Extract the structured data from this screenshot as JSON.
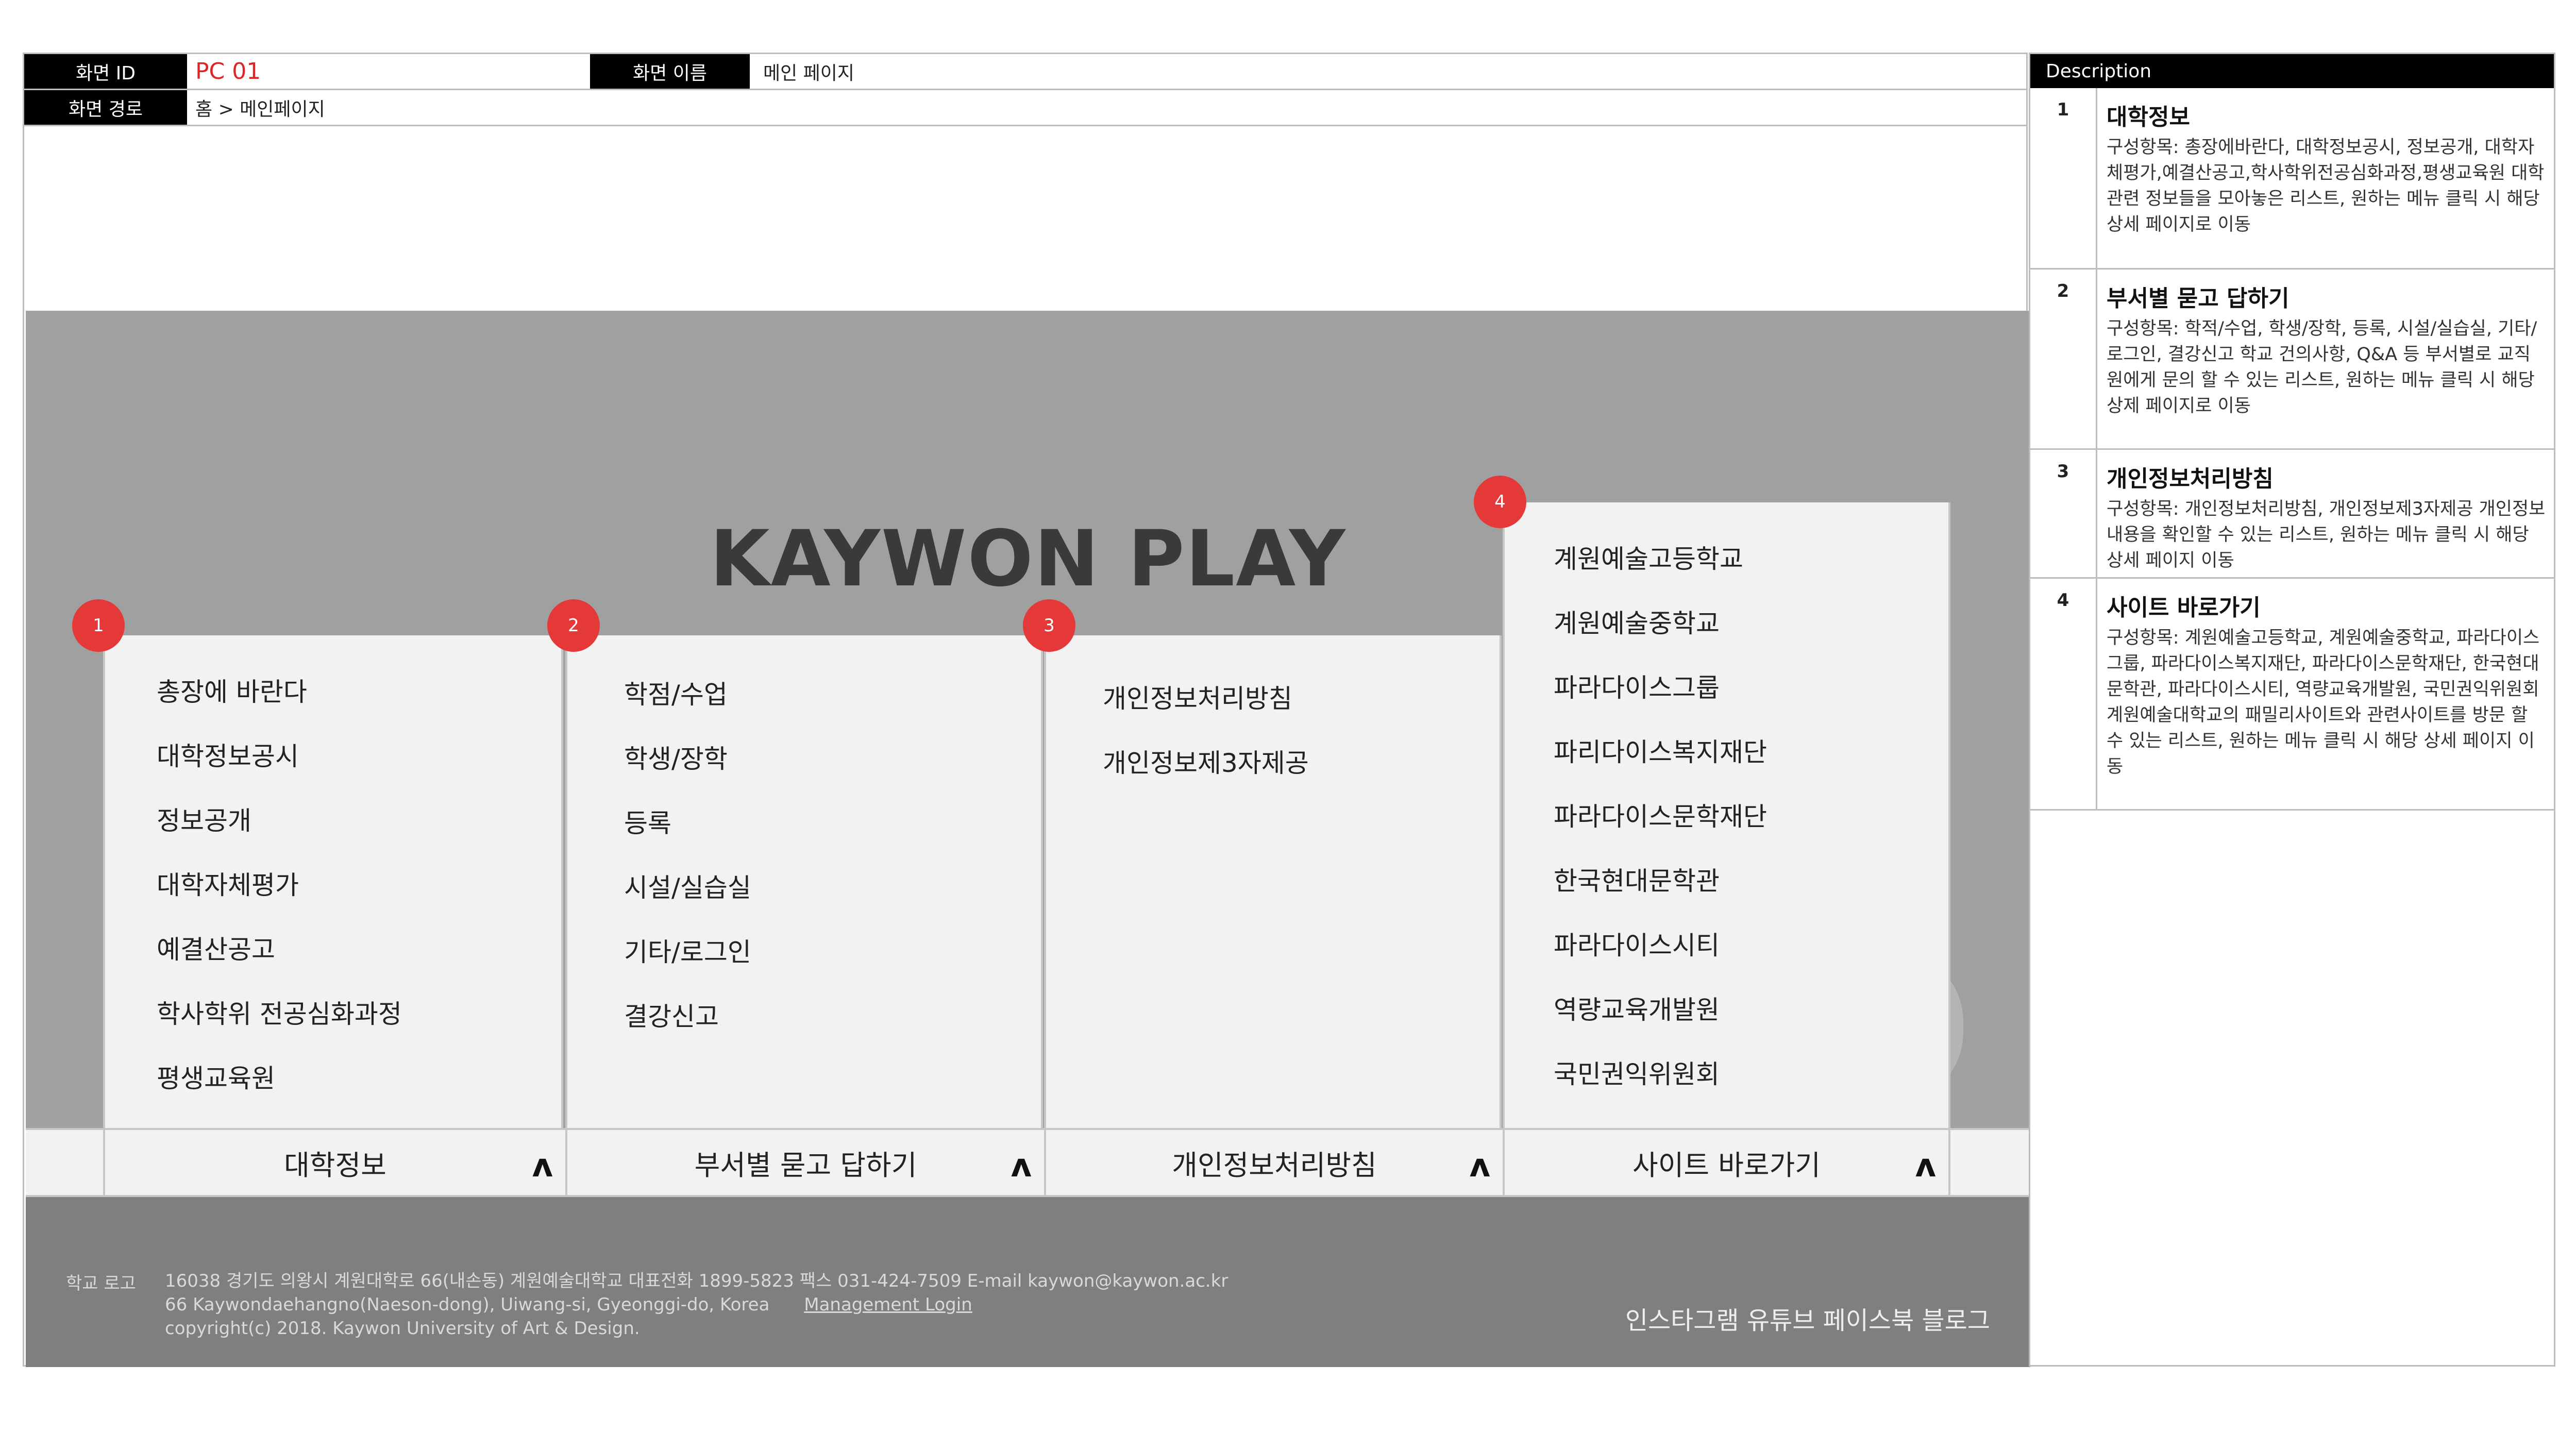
{
  "header": {
    "screen_id_label": "화면 ID",
    "screen_id_value": "PC 01",
    "screen_name_label": "화면 이름",
    "screen_name_value": "메인 페이지",
    "screen_path_label": "화면 경로",
    "screen_path_value": "홈 > 메인페이지"
  },
  "brand": "KAYWON PLAY",
  "markers": [
    "1",
    "2",
    "3",
    "4"
  ],
  "menus": {
    "university_info": {
      "tab_label": "대학정보",
      "items": [
        "총장에 바란다",
        "대학정보공시",
        "정보공개",
        "대학자체평가",
        "예결산공고",
        "학사학위 전공심화과정",
        "평생교육원"
      ]
    },
    "dept_qa": {
      "tab_label": "부서별 묻고 답하기",
      "items": [
        "학점/수업",
        "학생/장학",
        "등록",
        "시설/실습실",
        "기타/로그인",
        "결강신고"
      ]
    },
    "privacy": {
      "tab_label": "개인정보처리방침",
      "items": [
        "개인정보처리방침",
        "개인정보제3자제공"
      ]
    },
    "sites": {
      "tab_label": "사이트 바로가기",
      "items": [
        "계원예술고등학교",
        "계원예술중학교",
        "파라다이스그룹",
        "파리다이스복지재단",
        "파라다이스문학재단",
        "한국현대문학관",
        "파라다이스시티",
        "역량교육개발원",
        "국민권익위원회"
      ]
    },
    "caret": "ʌ"
  },
  "footer": {
    "logo": "학교 로고",
    "address_line1": "16038 경기도 의왕시 계원대학로 66(내손동) 계원예술대학교 대표전화 1899-5823 팩스 031-424-7509 E-mail kaywon@kaywon.ac.kr",
    "address_line2": "66 Kaywondaehangno(Naeson-dong), Uiwang-si, Gyeonggi-do, Korea",
    "management_login": "Management Login",
    "copyright": "copyright(c) 2018. Kaywon University of Art & Design.",
    "social": "인스타그램 유튜브 페이스북 블로그"
  },
  "description": {
    "header": "Description",
    "rows": [
      {
        "num": "1",
        "title": "대학정보",
        "text": "구성항목: 총장에바란다, 대학정보공시, 정보공개, 대학자체평가,예결산공고,학사학위전공심화과정,평생교육원 대학 관련 정보들을 모아놓은 리스트, 원하는 메뉴 클릭 시 해당 상세 페이지로 이동"
      },
      {
        "num": "2",
        "title": "부서별 묻고 답하기",
        "text": "구성항목: 학적/수업, 학생/장학, 등록, 시설/실습실, 기타/로그인, 결강신고 학교 건의사항, Q&A 등 부서별로 교직원에게 문의 할 수 있는 리스트, 원하는 메뉴 클릭 시 해당 상제 페이지로 이동"
      },
      {
        "num": "3",
        "title": "개인정보처리방침",
        "text": "구성항목: 개인정보처리방침, 개인정보제3자제공 개인정보내용을 확인할 수 있는 리스트, 원하는 메뉴 클릭 시 해당 상세 페이지 이동"
      },
      {
        "num": "4",
        "title": "사이트 바로가기",
        "text": "구성항목: 계원예술고등학교, 계원예술중학교, 파라다이스그룹, 파라다이스복지재단, 파라다이스문학재단, 한국현대문학관, 파라다이스시티, 역량교육개발원, 국민권익위원회 계원예술대학교의 패밀리사이트와 관련사이트를 방문 할 수 있는 리스트, 원하는 메뉴 클릭 시 해당 상세 페이지 이동"
      }
    ]
  },
  "colors": {
    "marker": "#e53838",
    "header_label_bg": "#000000",
    "screen_id": "#e02424",
    "stage_bg": "#a0a0a0",
    "panel_bg": "#f2f2f2",
    "footer_bg": "#7f7f7f"
  }
}
